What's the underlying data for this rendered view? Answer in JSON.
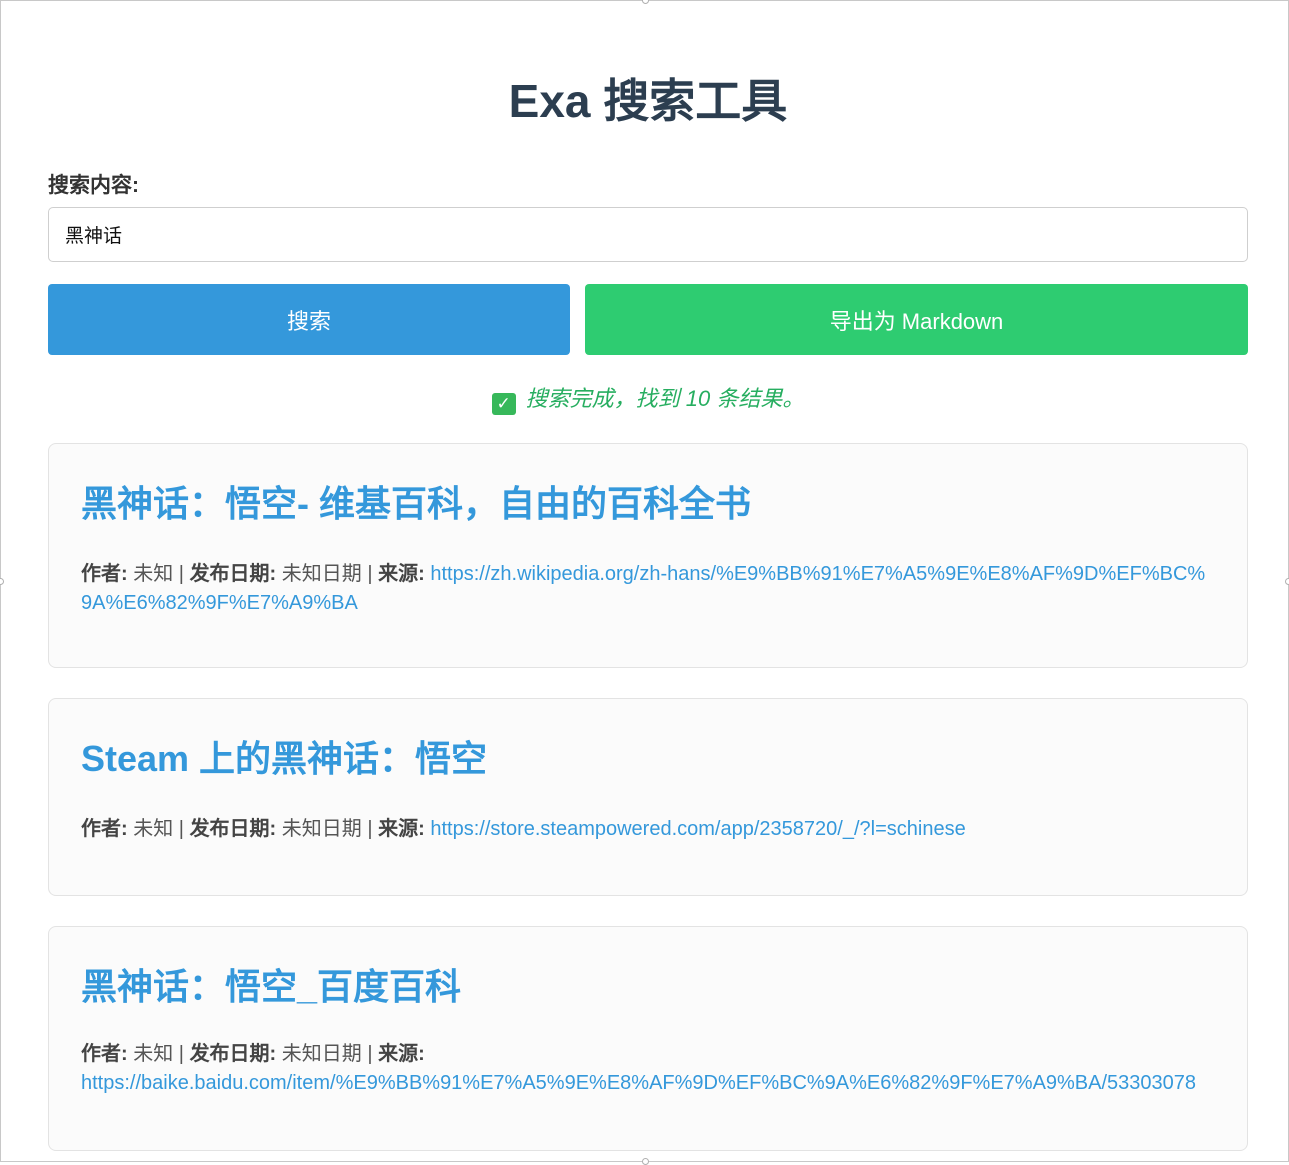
{
  "title": "Exa 搜索工具",
  "search": {
    "label": "搜索内容:",
    "value": "黑神话",
    "placeholder": ""
  },
  "buttons": {
    "search": "搜索",
    "export": "导出为 Markdown"
  },
  "status": {
    "icon": "check-icon",
    "text": "搜索完成，找到 10 条结果。"
  },
  "meta_labels": {
    "author": "作者:",
    "date": "发布日期:",
    "source": "来源:",
    "sep": "|"
  },
  "results": [
    {
      "title": "黑神话：悟空- 维基百科，自由的百科全书",
      "author": "未知",
      "date": "未知日期",
      "url": "https://zh.wikipedia.org/zh-hans/%E9%BB%91%E7%A5%9E%E8%AF%9D%EF%BC%9A%E6%82%9F%E7%A9%BA"
    },
    {
      "title": "Steam 上的黑神话：悟空",
      "author": "未知",
      "date": "未知日期",
      "url": "https://store.steampowered.com/app/2358720/_/?l=schinese"
    },
    {
      "title": "黑神话：悟空_百度百科",
      "author": "未知",
      "date": "未知日期",
      "url": "https://baike.baidu.com/item/%E9%BB%91%E7%A5%9E%E8%AF%9D%EF%BC%9A%E6%82%9F%E7%A9%BA/53303078"
    }
  ]
}
